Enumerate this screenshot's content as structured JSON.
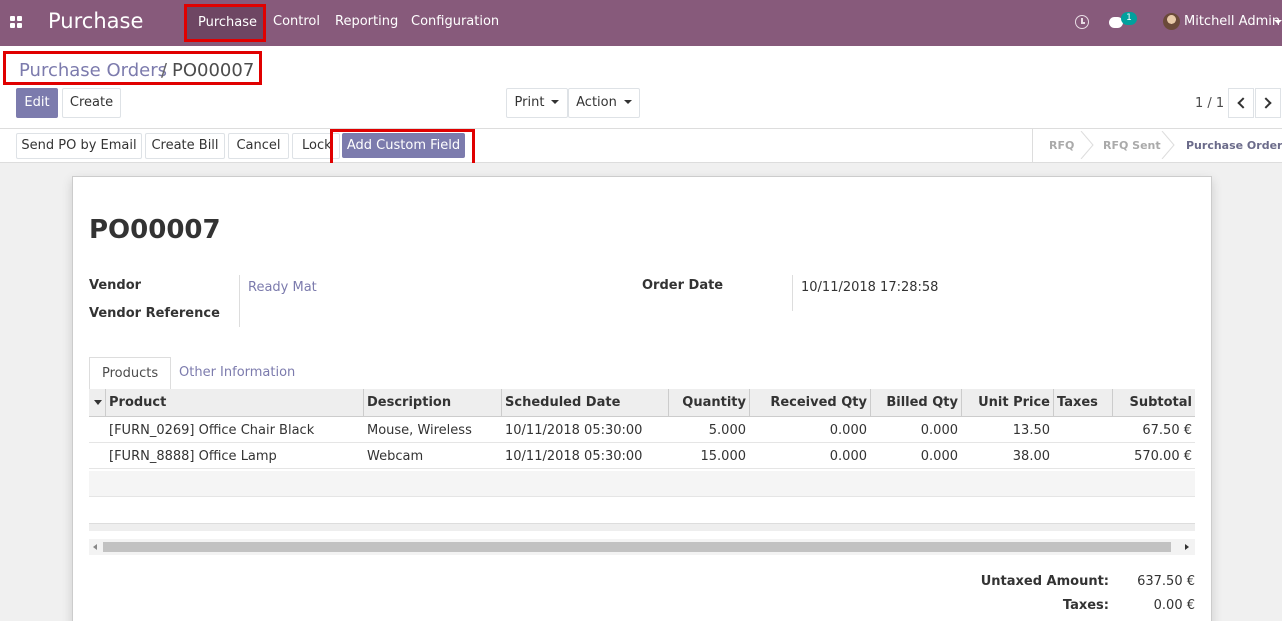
{
  "topbar": {
    "app_name": "Purchase",
    "menus": [
      "Purchase",
      "Control",
      "Reporting",
      "Configuration"
    ],
    "chat_count": "1",
    "user": "Mitchell Admin"
  },
  "control_panel": {
    "breadcrumb_parent": "Purchase Orders",
    "breadcrumb_sep": "/",
    "breadcrumb_current": "PO00007",
    "edit_label": "Edit",
    "create_label": "Create",
    "print_label": "Print",
    "action_label": "Action",
    "pager": "1 / 1"
  },
  "statusbar": {
    "buttons": [
      "Send PO by Email",
      "Create Bill",
      "Cancel",
      "Lock",
      "Add Custom Field"
    ],
    "stages": [
      "RFQ",
      "RFQ Sent",
      "Purchase Order"
    ],
    "active_stage": "Purchase Order"
  },
  "form": {
    "title": "PO00007",
    "vendor_label": "Vendor",
    "vendor_value": "Ready Mat",
    "vendor_ref_label": "Vendor Reference",
    "order_date_label": "Order Date",
    "order_date_value": "10/11/2018 17:28:58"
  },
  "tabs": [
    "Products",
    "Other Information"
  ],
  "table": {
    "columns": [
      "Product",
      "Description",
      "Scheduled Date",
      "Quantity",
      "Received Qty",
      "Billed Qty",
      "Unit Price",
      "Taxes",
      "Subtotal"
    ],
    "rows": [
      [
        "[FURN_0269] Office Chair Black",
        "Mouse, Wireless",
        "10/11/2018 05:30:00",
        "5.000",
        "0.000",
        "0.000",
        "13.50",
        "",
        "67.50 €"
      ],
      [
        "[FURN_8888] Office Lamp",
        "Webcam",
        "10/11/2018 05:30:00",
        "15.000",
        "0.000",
        "0.000",
        "38.00",
        "",
        "570.00 €"
      ]
    ]
  },
  "totals": {
    "untaxed_label": "Untaxed Amount:",
    "untaxed_value": "637.50 €",
    "taxes_label": "Taxes:",
    "taxes_value": "0.00 €"
  },
  "colors": {
    "nav": "#875a7b",
    "primary": "#7c7bad",
    "highlight": "#e00000"
  }
}
